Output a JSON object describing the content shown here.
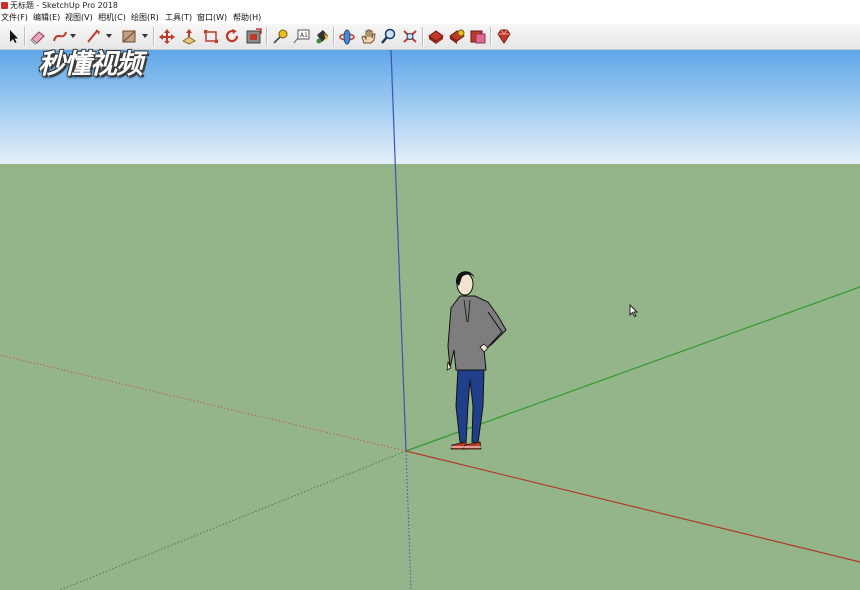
{
  "window": {
    "title": "无标题 - SketchUp Pro 2018"
  },
  "menu": {
    "items": [
      {
        "label": "文件(F)"
      },
      {
        "label": "编辑(E)"
      },
      {
        "label": "视图(V)"
      },
      {
        "label": "相机(C)"
      },
      {
        "label": "绘图(R)"
      },
      {
        "label": "工具(T)"
      },
      {
        "label": "窗口(W)"
      },
      {
        "label": "帮助(H)"
      }
    ]
  },
  "toolbar": {
    "tools": [
      {
        "icon": "select-arrow-icon"
      },
      {
        "icon": "eraser-icon"
      },
      {
        "icon": "freehand-line-icon"
      },
      {
        "icon": "line-pencil-icon"
      },
      {
        "icon": "rectangle-shape-icon"
      },
      {
        "icon": "move-icon"
      },
      {
        "icon": "push-pull-icon"
      },
      {
        "icon": "scale-icon"
      },
      {
        "icon": "rotate-icon"
      },
      {
        "icon": "offset-icon"
      },
      {
        "icon": "tape-measure-icon"
      },
      {
        "icon": "text-label-icon"
      },
      {
        "icon": "paint-bucket-icon"
      },
      {
        "icon": "orbit-icon"
      },
      {
        "icon": "pan-hand-icon"
      },
      {
        "icon": "zoom-icon"
      },
      {
        "icon": "zoom-extents-icon"
      },
      {
        "icon": "3d-warehouse-icon"
      },
      {
        "icon": "extension-warehouse-icon"
      },
      {
        "icon": "send-to-layout-icon"
      },
      {
        "icon": "ruby-console-icon"
      }
    ]
  },
  "watermark": {
    "text": "秒懂视频"
  },
  "colors": {
    "sky_top": "#5ea6e8",
    "sky_bottom": "#dcecf8",
    "ground": "#94b58a",
    "axis_blue": "#3a55b0",
    "axis_green": "#2f9a2f",
    "axis_red": "#b23a2a"
  }
}
